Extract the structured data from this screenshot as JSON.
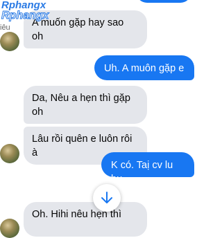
{
  "watermark": {
    "line1": "Rphangx",
    "line2": "Rphangx"
  },
  "avatar_label": "iêu",
  "messages": [
    {
      "side": "incoming",
      "text_line1": "A muốn gặp hay sao",
      "text_line2": "oh"
    },
    {
      "side": "outgoing",
      "text": "Uh. A muôn gặp e"
    },
    {
      "side": "incoming",
      "text_line1": "Da, Nêu a hẹn thì gặp",
      "text_line2": "oh"
    },
    {
      "side": "incoming",
      "text_line1": "Lâu rồi quên e luôn rôi",
      "text_line2": "à"
    },
    {
      "side": "outgoing",
      "text": "K có. Taị cv lu bu"
    },
    {
      "side": "incoming",
      "text_line1": "Oh. Hihi nêu hẹn thì"
    }
  ],
  "colors": {
    "outgoing_bubble": "#1877f2",
    "incoming_bubble": "#e4e6eb",
    "scroll_button_icon": "#1877f2"
  },
  "icons": {
    "scroll_down": "arrow-down-icon"
  }
}
